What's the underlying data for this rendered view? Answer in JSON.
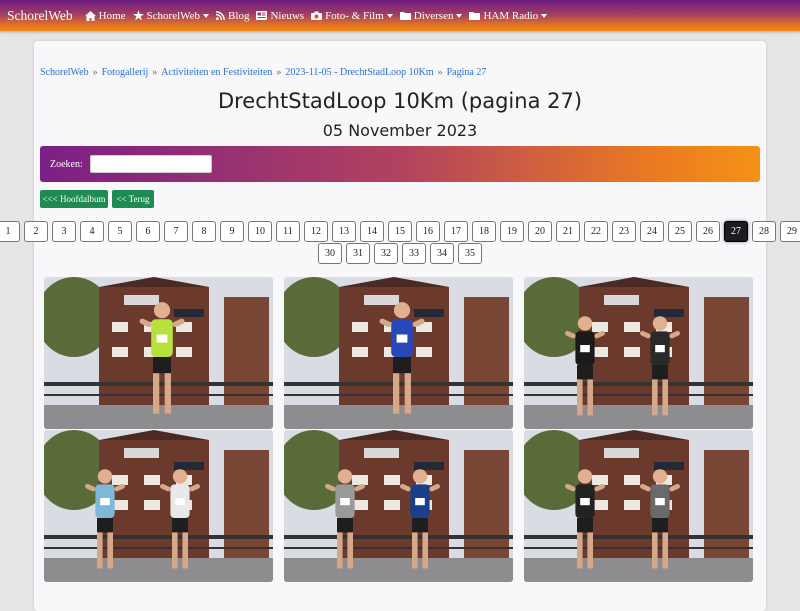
{
  "navbar": {
    "brand": "SchorelWeb",
    "items": [
      {
        "label": "Home",
        "icon": "home-icon",
        "dropdown": false
      },
      {
        "label": "SchorelWeb",
        "icon": "star-icon",
        "dropdown": true
      },
      {
        "label": "Blog",
        "icon": "rss-icon",
        "dropdown": false
      },
      {
        "label": "Nieuws",
        "icon": "newspaper-icon",
        "dropdown": false
      },
      {
        "label": "Foto- & Film",
        "icon": "camera-icon",
        "dropdown": true
      },
      {
        "label": "Diversen",
        "icon": "folder-icon",
        "dropdown": true
      },
      {
        "label": "HAM Radio",
        "icon": "folder-icon",
        "dropdown": true
      }
    ]
  },
  "breadcrumb": [
    "SchorelWeb",
    "Fotogallerij",
    "Activiteiten en Festiviteiten",
    "2023-11-05 - DrechtStadLoop 10Km",
    "Pagina 27"
  ],
  "page": {
    "title": "DrechtStadLoop 10Km (pagina 27)",
    "date": "05 November 2023"
  },
  "search": {
    "label": "Zoeken:",
    "value": ""
  },
  "buttons": {
    "main_album": "<<< Hoofdalbum",
    "back": "<< Terug"
  },
  "pagination": {
    "row1": [
      "1",
      "2",
      "3",
      "4",
      "5",
      "6",
      "7",
      "8",
      "9",
      "10",
      "11",
      "12",
      "13",
      "14",
      "15",
      "16",
      "17",
      "18",
      "19",
      "20",
      "21",
      "22",
      "23",
      "24",
      "25",
      "26",
      "27",
      "28",
      "29"
    ],
    "row2": [
      "30",
      "31",
      "32",
      "33",
      "34",
      "35"
    ],
    "active": "27"
  },
  "photos": [
    {
      "id": "photo-1",
      "runners": [
        {
          "shirt": "#b7e03a",
          "bib": true
        }
      ]
    },
    {
      "id": "photo-2",
      "runners": [
        {
          "shirt": "#2748b8",
          "bib": true
        }
      ]
    },
    {
      "id": "photo-3",
      "runners": [
        {
          "shirt": "#1a1a1a",
          "bib": true
        },
        {
          "shirt": "#2a2a2a",
          "bib": true
        }
      ]
    },
    {
      "id": "photo-4",
      "runners": [
        {
          "shirt": "#7fb7d8",
          "bib": true
        },
        {
          "shirt": "#e8e8e8",
          "bib": true
        }
      ]
    },
    {
      "id": "photo-5",
      "runners": [
        {
          "shirt": "#9a9a9a",
          "bib": true
        },
        {
          "shirt": "#1c3f8a",
          "bib": true
        }
      ]
    },
    {
      "id": "photo-6",
      "runners": [
        {
          "shirt": "#222222",
          "bib": true
        },
        {
          "shirt": "#6a6a6a",
          "bib": true
        }
      ]
    }
  ]
}
